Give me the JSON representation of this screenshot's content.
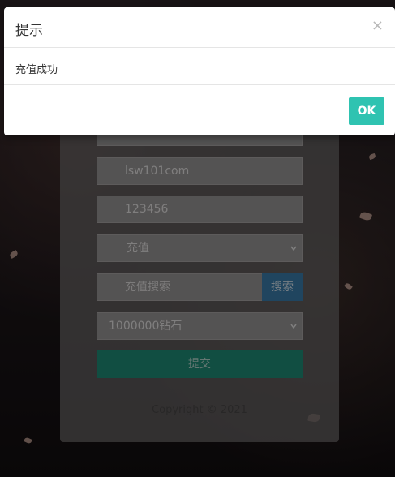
{
  "form": {
    "account_value": "lsw101com",
    "password_value": "123456",
    "type_selected": "充值",
    "search_placeholder": "充值搜索",
    "search_button": "搜索",
    "item_selected": "1000000钻石",
    "submit_button": "提交",
    "copyright": "Copyright © 2021"
  },
  "modal": {
    "title": "提示",
    "close_glyph": "×",
    "message": "充值成功",
    "ok_button": "OK"
  }
}
